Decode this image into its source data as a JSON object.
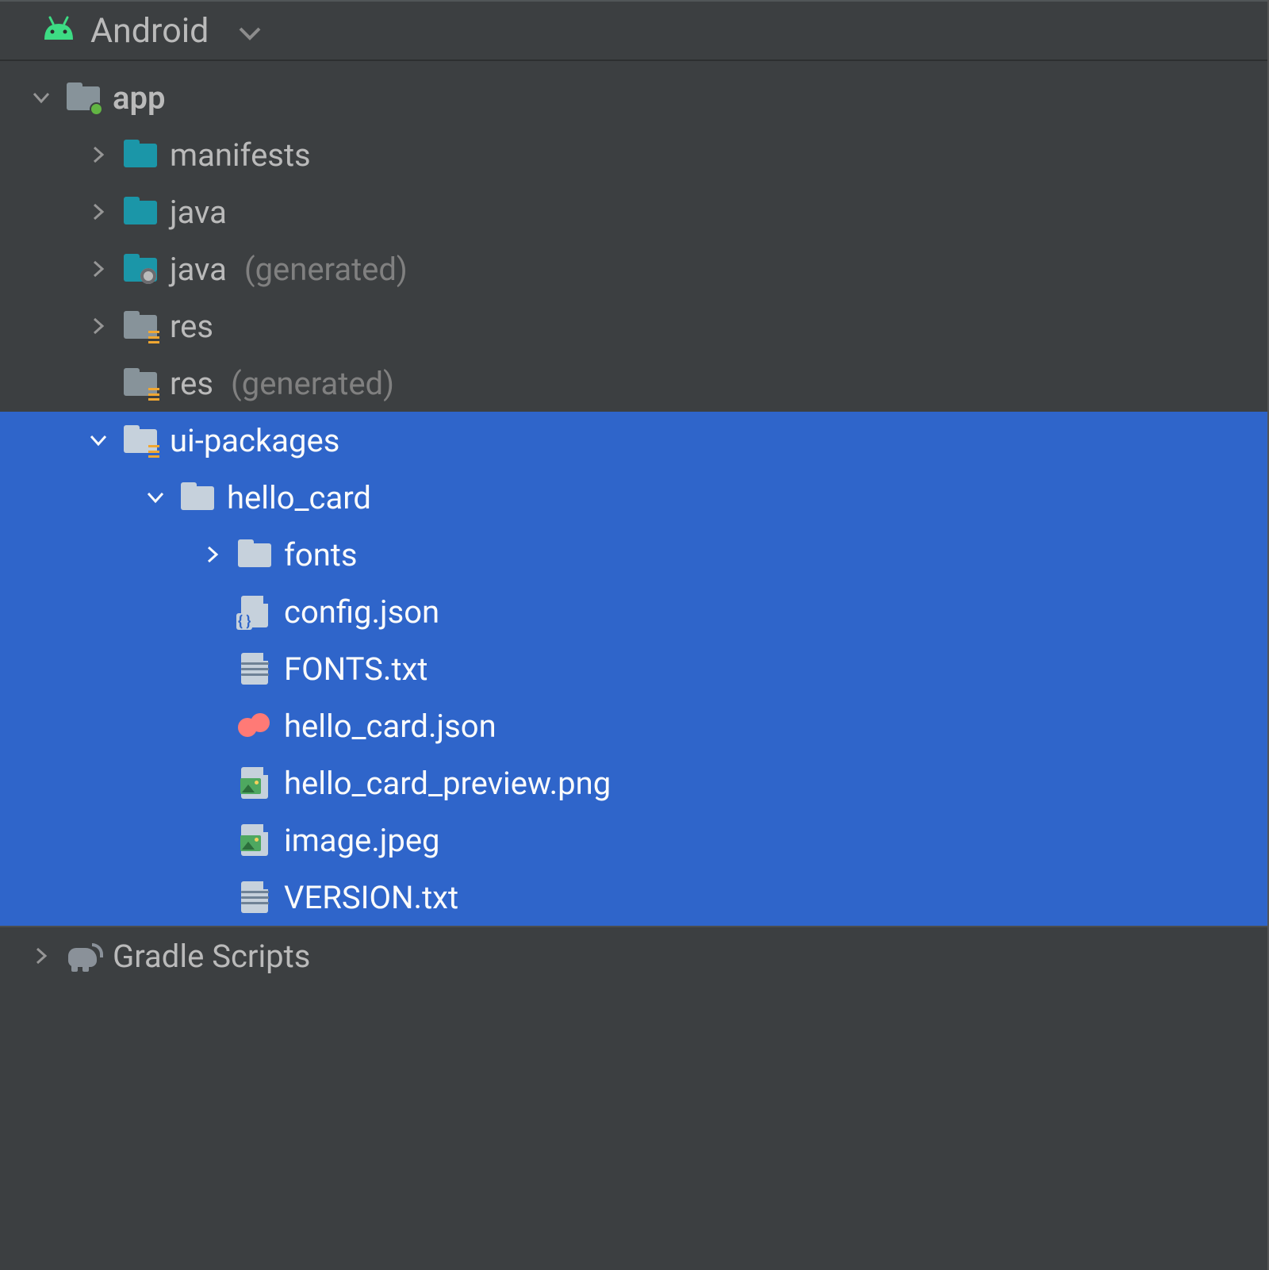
{
  "header": {
    "title": "Android"
  },
  "tree": {
    "app": {
      "label": "app",
      "manifests": {
        "label": "manifests"
      },
      "java": {
        "label": "java"
      },
      "java_gen": {
        "label": "java",
        "suffix": "(generated)"
      },
      "res": {
        "label": "res"
      },
      "res_gen": {
        "label": "res",
        "suffix": "(generated)"
      },
      "ui_packages": {
        "label": "ui-packages",
        "hello_card": {
          "label": "hello_card",
          "fonts": {
            "label": "fonts"
          },
          "files": {
            "config": "config.json",
            "fonts_txt": "FONTS.txt",
            "hello_card_json": "hello_card.json",
            "preview_png": "hello_card_preview.png",
            "image_jpeg": "image.jpeg",
            "version_txt": "VERSION.txt"
          }
        }
      }
    },
    "gradle": {
      "label": "Gradle Scripts"
    }
  }
}
